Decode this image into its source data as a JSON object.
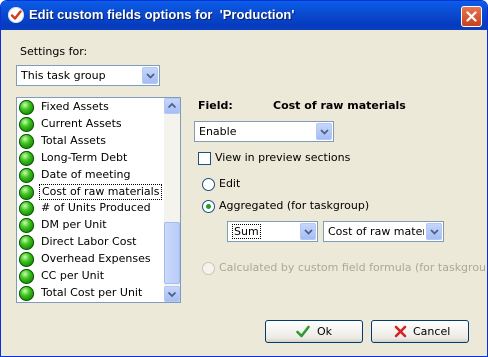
{
  "window": {
    "title": "Edit custom fields options for  'Production'",
    "title_icon": "check-badge-icon",
    "close_icon": "close-icon"
  },
  "settings": {
    "label": "Settings for:",
    "selected": "This task group"
  },
  "fields_list": {
    "items": [
      {
        "label": "Fixed Assets"
      },
      {
        "label": "Current Assets"
      },
      {
        "label": "Total Assets"
      },
      {
        "label": "Long-Term Debt"
      },
      {
        "label": "Date of meeting"
      },
      {
        "label": "Cost of raw materials",
        "selected": true
      },
      {
        "label": "# of Units Produced"
      },
      {
        "label": "DM per Unit"
      },
      {
        "label": "Direct Labor Cost"
      },
      {
        "label": "Overhead Expenses"
      },
      {
        "label": "CC per Unit"
      },
      {
        "label": "Total Cost per Unit"
      }
    ],
    "item_icon": "green-status-ball-icon"
  },
  "field_panel": {
    "field_label": "Field:",
    "field_name": "Cost of raw materials",
    "enable_selected": "Enable",
    "preview_label": "View in preview sections",
    "preview_checked": false,
    "edit_label": "Edit",
    "aggregated_label": "Aggregated (for taskgroup)",
    "aggregate_function": "Sum",
    "aggregate_field": "Cost of raw materials",
    "formula_label": "Calculated by custom field formula (for taskgroup)",
    "selected_mode": "aggregated"
  },
  "buttons": {
    "ok": "Ok",
    "cancel": "Cancel"
  },
  "colors": {
    "titlebar": "#0a4bd2",
    "dialog_bg": "#ece9d8",
    "ok_check": "#2e9a2e",
    "cancel_x": "#d22323"
  }
}
